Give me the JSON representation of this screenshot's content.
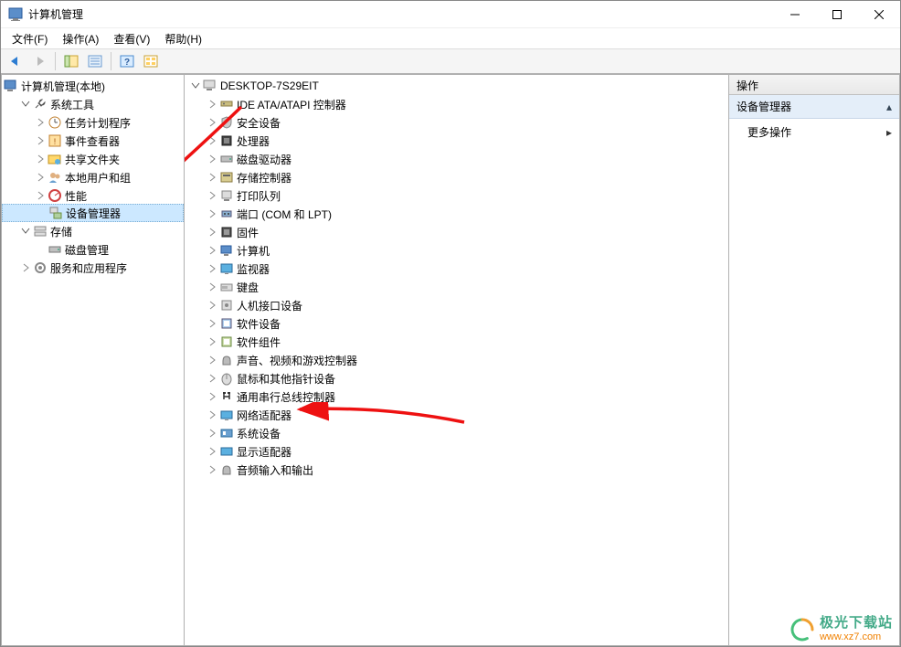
{
  "window": {
    "title": "计算机管理",
    "menus": [
      "文件(F)",
      "操作(A)",
      "查看(V)",
      "帮助(H)"
    ]
  },
  "left_tree": {
    "root": "计算机管理(本地)",
    "system_tools": {
      "label": "系统工具",
      "items": [
        "任务计划程序",
        "事件查看器",
        "共享文件夹",
        "本地用户和组",
        "性能",
        "设备管理器"
      ]
    },
    "storage": {
      "label": "存储",
      "items": [
        "磁盘管理"
      ]
    },
    "services": "服务和应用程序"
  },
  "device_tree": {
    "root": "DESKTOP-7S29EIT",
    "categories": [
      "IDE ATA/ATAPI 控制器",
      "安全设备",
      "处理器",
      "磁盘驱动器",
      "存储控制器",
      "打印队列",
      "端口 (COM 和 LPT)",
      "固件",
      "计算机",
      "监视器",
      "键盘",
      "人机接口设备",
      "软件设备",
      "软件组件",
      "声音、视频和游戏控制器",
      "鼠标和其他指针设备",
      "通用串行总线控制器",
      "网络适配器",
      "系统设备",
      "显示适配器",
      "音频输入和输出"
    ]
  },
  "actions": {
    "header": "操作",
    "sub": "设备管理器",
    "more": "更多操作"
  },
  "watermark": {
    "name": "极光下载站",
    "url": "www.xz7.com"
  }
}
